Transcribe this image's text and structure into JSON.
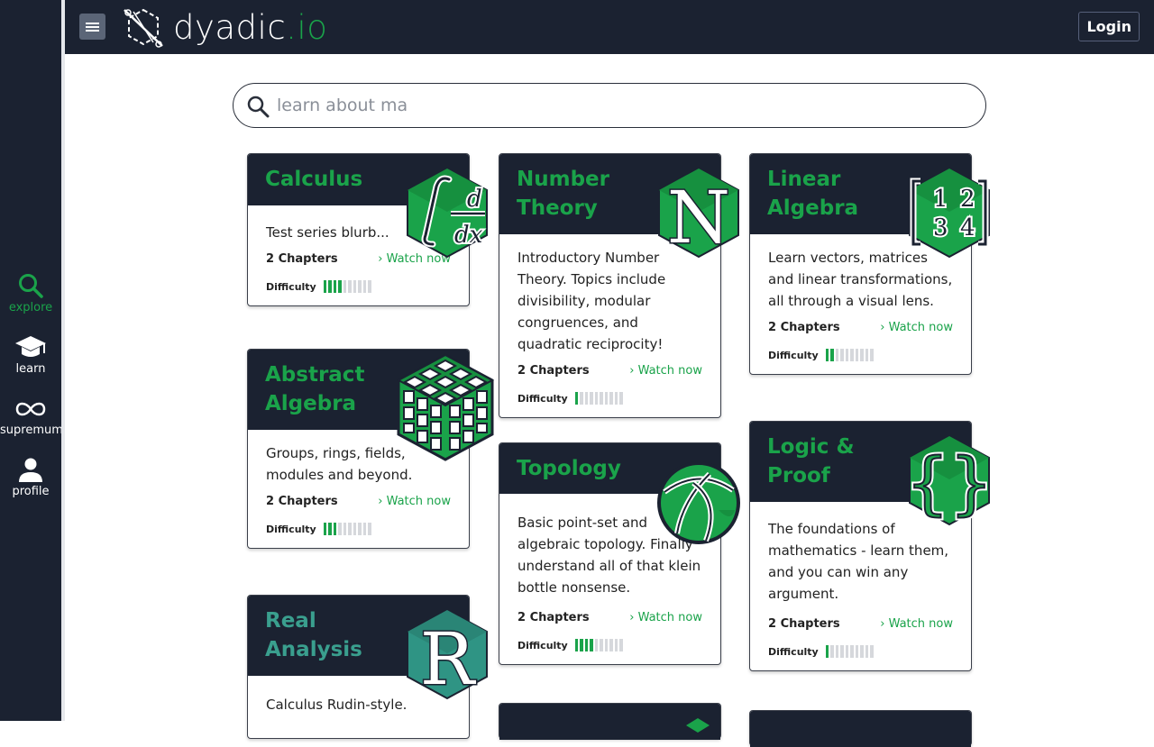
{
  "app": {
    "logo_main": "dyadic",
    "logo_tld": ".io"
  },
  "header": {
    "login_label": "Login"
  },
  "sidebar": {
    "items": [
      {
        "label": "explore",
        "icon": "search-icon"
      },
      {
        "label": "learn",
        "icon": "graduation-cap-icon"
      },
      {
        "label": "supremum",
        "icon": "infinity-icon"
      },
      {
        "label": "profile",
        "icon": "person-icon"
      }
    ]
  },
  "search": {
    "value": "",
    "placeholder": "learn about ma"
  },
  "colors": {
    "accent": "#1aa34a",
    "dark": "#1b2231",
    "teal": "#3a9f8e"
  },
  "cards": [
    {
      "title": "Calculus",
      "desc": "Test series blurb...",
      "chapters": "2 Chapters",
      "watch": "› Watch now",
      "difficulty_label": "Difficulty",
      "difficulty": 4,
      "icon": "integral-icon"
    },
    {
      "title": "Number Theory",
      "desc": "Introductory Number Theory. Topics include divisibility, modular congruences, and quadratic reciprocity!",
      "chapters": "2 Chapters",
      "watch": "› Watch now",
      "difficulty_label": "Difficulty",
      "difficulty": 1,
      "icon": "naturals-icon"
    },
    {
      "title": "Linear Algebra",
      "desc": "Learn vectors, matrices and linear transformations, all through a visual lens.",
      "chapters": "2 Chapters",
      "watch": "› Watch now",
      "difficulty_label": "Difficulty",
      "difficulty": 2,
      "icon": "matrix-icon"
    },
    {
      "title": "Abstract Algebra",
      "desc": "Groups, rings, fields, modules and beyond.",
      "chapters": "2 Chapters",
      "watch": "› Watch now",
      "difficulty_label": "Difficulty",
      "difficulty": 3,
      "icon": "cube-icon"
    },
    {
      "title": "Topology",
      "desc": "Basic point-set and algebraic topology. Finally understand all of that klein bottle nonsense.",
      "chapters": "2 Chapters",
      "watch": "› Watch now",
      "difficulty_label": "Difficulty",
      "difficulty": 4,
      "icon": "sphere-icon"
    },
    {
      "title": "Logic & Proof",
      "desc": "The foundations of mathematics - learn them, and you can win any argument.",
      "chapters": "2 Chapters",
      "watch": "› Watch now",
      "difficulty_label": "Difficulty",
      "difficulty": 1,
      "icon": "braces-icon"
    },
    {
      "title": "Real Analysis",
      "desc": "Calculus Rudin-style.",
      "icon": "reals-icon"
    }
  ]
}
